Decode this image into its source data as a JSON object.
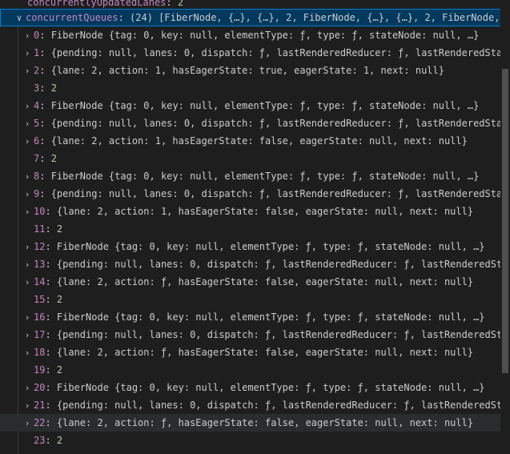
{
  "top_line": {
    "key": "concurrentlyUpdatedLanes",
    "value": "2"
  },
  "header": {
    "key": "concurrentQueues",
    "summary": "(24) [FiberNode, {…}, {…}, 2, FiberNode, {…}, {…}, 2, FiberNode, …"
  },
  "entries": [
    {
      "index": "0",
      "value": "FiberNode {tag: 0, key: null, elementType: ƒ, type: ƒ, stateNode: null, …}",
      "expandable": true
    },
    {
      "index": "1",
      "value": "{pending: null, lanes: 0, dispatch: ƒ, lastRenderedReducer: ƒ, lastRenderedSta…",
      "expandable": true
    },
    {
      "index": "2",
      "value": "{lane: 2, action: 1, hasEagerState: true, eagerState: 1, next: null}",
      "expandable": true
    },
    {
      "index": "3",
      "value": "2",
      "expandable": false
    },
    {
      "index": "4",
      "value": "FiberNode {tag: 0, key: null, elementType: ƒ, type: ƒ, stateNode: null, …}",
      "expandable": true
    },
    {
      "index": "5",
      "value": "{pending: null, lanes: 0, dispatch: ƒ, lastRenderedReducer: ƒ, lastRenderedSta…",
      "expandable": true
    },
    {
      "index": "6",
      "value": "{lane: 2, action: 1, hasEagerState: false, eagerState: null, next: null}",
      "expandable": true
    },
    {
      "index": "7",
      "value": "2",
      "expandable": false
    },
    {
      "index": "8",
      "value": "FiberNode {tag: 0, key: null, elementType: ƒ, type: ƒ, stateNode: null, …}",
      "expandable": true
    },
    {
      "index": "9",
      "value": "{pending: null, lanes: 0, dispatch: ƒ, lastRenderedReducer: ƒ, lastRenderedSta…",
      "expandable": true
    },
    {
      "index": "10",
      "value": "{lane: 2, action: 1, hasEagerState: false, eagerState: null, next: null}",
      "expandable": true
    },
    {
      "index": "11",
      "value": "2",
      "expandable": false
    },
    {
      "index": "12",
      "value": "FiberNode {tag: 0, key: null, elementType: ƒ, type: ƒ, stateNode: null, …}",
      "expandable": true
    },
    {
      "index": "13",
      "value": "{pending: null, lanes: 0, dispatch: ƒ, lastRenderedReducer: ƒ, lastRenderedSt…",
      "expandable": true
    },
    {
      "index": "14",
      "value": "{lane: 2, action: ƒ, hasEagerState: false, eagerState: null, next: null}",
      "expandable": true
    },
    {
      "index": "15",
      "value": "2",
      "expandable": false
    },
    {
      "index": "16",
      "value": "FiberNode {tag: 0, key: null, elementType: ƒ, type: ƒ, stateNode: null, …}",
      "expandable": true
    },
    {
      "index": "17",
      "value": "{pending: null, lanes: 0, dispatch: ƒ, lastRenderedReducer: ƒ, lastRenderedSt…",
      "expandable": true
    },
    {
      "index": "18",
      "value": "{lane: 2, action: ƒ, hasEagerState: false, eagerState: null, next: null}",
      "expandable": true
    },
    {
      "index": "19",
      "value": "2",
      "expandable": false
    },
    {
      "index": "20",
      "value": "FiberNode {tag: 0, key: null, elementType: ƒ, type: ƒ, stateNode: null, …}",
      "expandable": true
    },
    {
      "index": "21",
      "value": "{pending: null, lanes: 0, dispatch: ƒ, lastRenderedReducer: ƒ, lastRenderedSt…",
      "expandable": true
    },
    {
      "index": "22",
      "value": "{lane: 2, action: ƒ, hasEagerState: false, eagerState: null, next: null}",
      "expandable": true,
      "hovered": true
    },
    {
      "index": "23",
      "value": "2",
      "expandable": false
    }
  ]
}
